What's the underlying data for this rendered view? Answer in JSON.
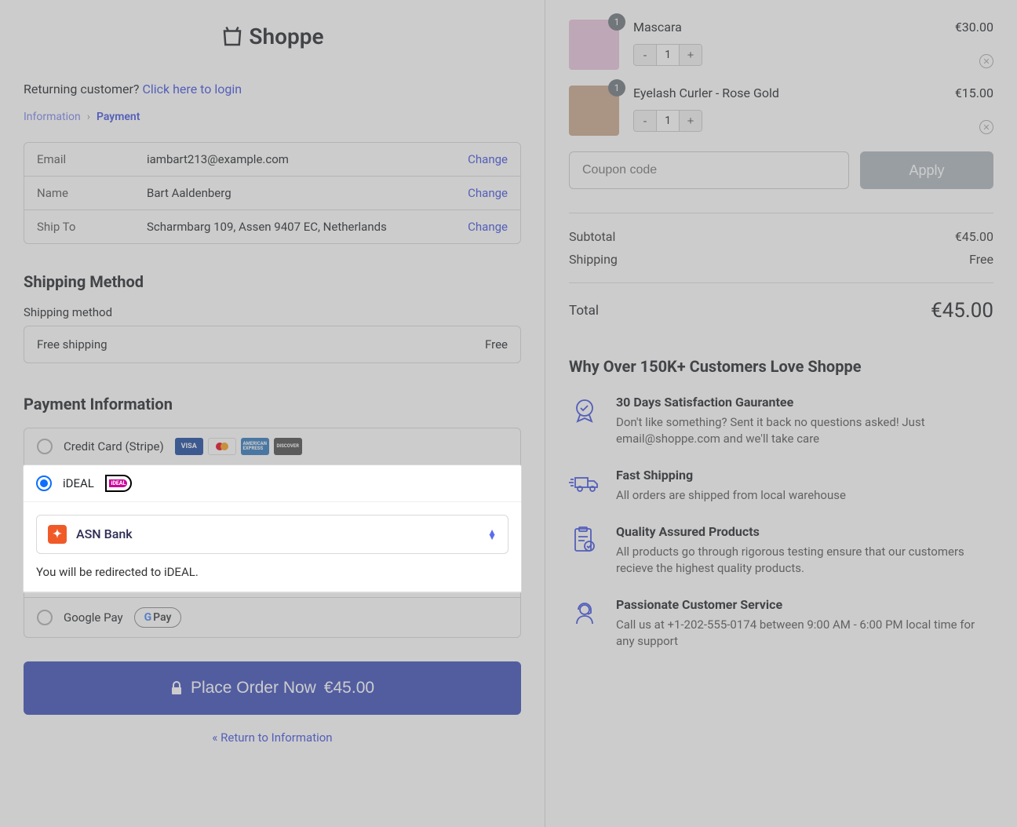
{
  "logo": "Shoppe",
  "returning": {
    "text": "Returning customer? ",
    "link": "Click here to login"
  },
  "breadcrumb": {
    "step1": "Information",
    "step2": "Payment"
  },
  "info": {
    "email_label": "Email",
    "email_value": "iambart213@example.com",
    "name_label": "Name",
    "name_value": "Bart Aaldenberg",
    "ship_label": "Ship To",
    "ship_value": "Scharmbarg 109, Assen 9407 EC, Netherlands",
    "change": "Change"
  },
  "shipping": {
    "heading": "Shipping Method",
    "sub": "Shipping method",
    "method": "Free shipping",
    "cost": "Free"
  },
  "payment": {
    "heading": "Payment Information",
    "cc_label": "Credit Card (Stripe)",
    "ideal_label": "iDEAL",
    "bank_selected": "ASN Bank",
    "redirect_note": "You will be redirected to iDEAL.",
    "gpay_label": "Google Pay"
  },
  "place_order": {
    "label": "Place Order Now",
    "amount": "€45.00"
  },
  "return_link": "« Return to Information",
  "cart": {
    "items": [
      {
        "name": "Mascara",
        "qty": "1",
        "price": "€30.00",
        "badge": "1",
        "bg": "#e9c3dc"
      },
      {
        "name": "Eyelash Curler - Rose Gold",
        "qty": "1",
        "price": "€15.00",
        "badge": "1",
        "bg": "#c9a58c"
      }
    ],
    "coupon_placeholder": "Coupon code",
    "apply": "Apply",
    "subtotal_label": "Subtotal",
    "subtotal_value": "€45.00",
    "shipping_label": "Shipping",
    "shipping_value": "Free",
    "total_label": "Total",
    "total_value": "€45.00"
  },
  "why": {
    "heading": "Why Over 150K+ Customers Love Shoppe",
    "benefits": [
      {
        "title": "30 Days Satisfaction Gaurantee",
        "text": "Don't like something? Sent it back no questions asked! Just email@shoppe.com and we'll take care"
      },
      {
        "title": "Fast Shipping",
        "text": "All orders are shipped from local warehouse"
      },
      {
        "title": "Quality Assured Products",
        "text": "All products go through rigorous testing ensure that our customers recieve the highest quality products."
      },
      {
        "title": "Passionate Customer Service",
        "text": "Call us at +1-202-555-0174 between 9:00 AM - 6:00 PM local time for any support"
      }
    ]
  }
}
